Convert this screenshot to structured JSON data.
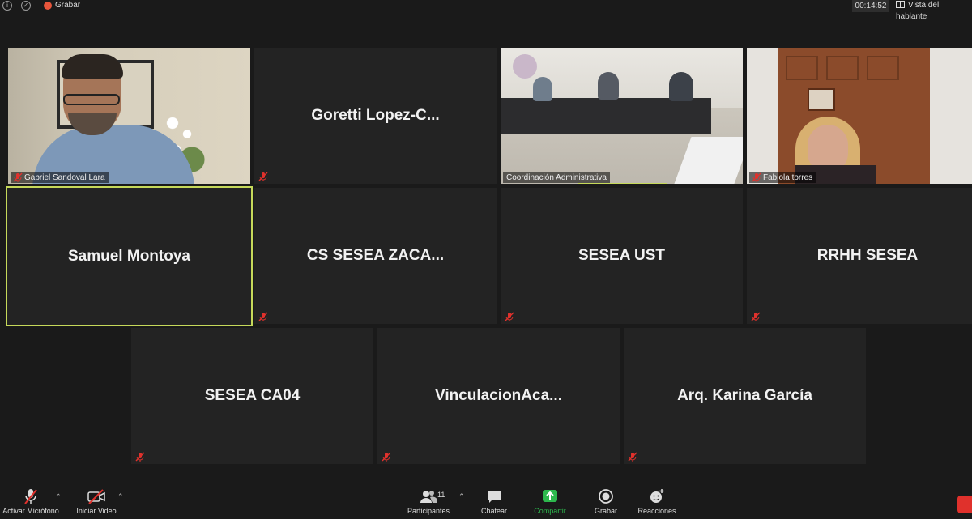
{
  "topbar": {
    "recording_label": "Grabar",
    "timer": "00:14:52",
    "view_label": "Vista del hablante"
  },
  "tiles": [
    {
      "name": "Gabriel Sandoval Lara",
      "type": "video"
    },
    {
      "name": "Goretti  Lopez-C...",
      "type": "name"
    },
    {
      "name": "Coordinación Administrativa",
      "type": "video"
    },
    {
      "name": "Fabiola torres",
      "type": "video"
    },
    {
      "name": "Samuel Montoya",
      "type": "name",
      "active_speaker": true
    },
    {
      "name": "CS SESEA ZACA...",
      "type": "name"
    },
    {
      "name": "SESEA UST",
      "type": "name"
    },
    {
      "name": "RRHH SESEA",
      "type": "name"
    },
    {
      "name": "SESEA CA04",
      "type": "name"
    },
    {
      "name": "VinculacionAca...",
      "type": "name"
    },
    {
      "name": "Arq. Karina García",
      "type": "name"
    }
  ],
  "toolbar": {
    "mic_label": "Activar Micrófono",
    "video_label": "Iniciar Video",
    "participants_label": "Participantes",
    "participants_count": "11",
    "chat_label": "Chatear",
    "share_label": "Compartir",
    "record_label": "Grabar",
    "reactions_label": "Reacciones"
  },
  "colors": {
    "active_border": "#c6d95a",
    "share_green": "#2db84d",
    "record_red": "#e8553b",
    "end_red": "#e0312c"
  }
}
